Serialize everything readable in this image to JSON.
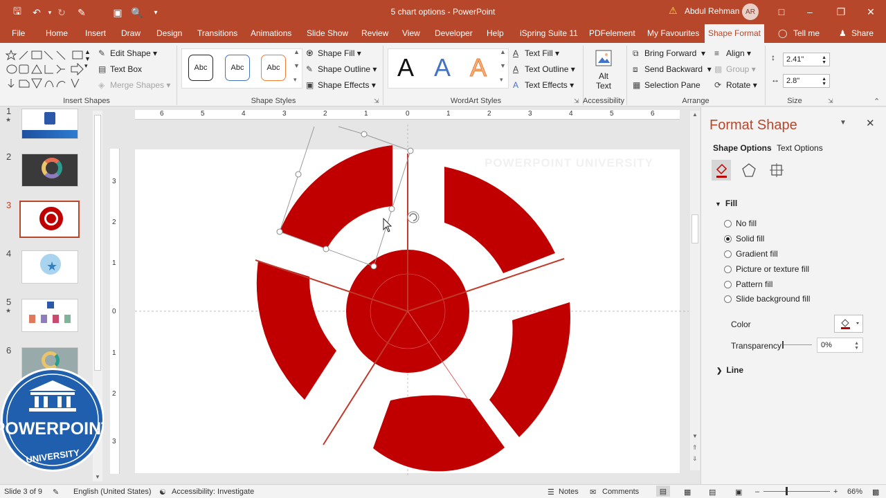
{
  "title_bar": {
    "document_title": "5 chart options - PowerPoint",
    "user_name": "Abdul Rehman",
    "avatar_initials": "AR",
    "quick_access": [
      "save-icon",
      "undo-icon",
      "redo-icon",
      "format-painter-icon",
      "from-beginning-icon",
      "print-preview-icon",
      "customize-icon"
    ]
  },
  "menu_tabs": [
    "File",
    "Home",
    "Insert",
    "Draw",
    "Design",
    "Transitions",
    "Animations",
    "Slide Show",
    "Review",
    "View",
    "Developer",
    "Help",
    "iSpring Suite 11",
    "PDFelement",
    "My Favourites",
    "Shape Format",
    "Tell me",
    "Share"
  ],
  "active_tab": "Shape Format",
  "ribbon": {
    "insert_shapes": {
      "label": "Insert Shapes",
      "edit_shape": "Edit Shape",
      "text_box": "Text Box",
      "merge_shapes": "Merge Shapes"
    },
    "shape_styles": {
      "label": "Shape Styles",
      "samples": [
        "Abc",
        "Abc",
        "Abc"
      ],
      "shape_fill": "Shape Fill",
      "shape_outline": "Shape Outline",
      "shape_effects": "Shape Effects"
    },
    "wordart_styles": {
      "label": "WordArt Styles",
      "samples": [
        "A",
        "A",
        "A"
      ],
      "text_fill": "Text Fill",
      "text_outline": "Text Outline",
      "text_effects": "Text Effects"
    },
    "accessibility": {
      "label": "Accessibility",
      "alt_text_line1": "Alt",
      "alt_text_line2": "Text"
    },
    "arrange": {
      "label": "Arrange",
      "bring_forward": "Bring Forward",
      "send_backward": "Send Backward",
      "selection_pane": "Selection Pane",
      "align": "Align",
      "group": "Group",
      "rotate": "Rotate"
    },
    "size": {
      "label": "Size",
      "height": "2.41\"",
      "width": "2.8\""
    }
  },
  "slides": [
    {
      "number": "1",
      "starred": true
    },
    {
      "number": "2",
      "starred": false
    },
    {
      "number": "3",
      "starred": false,
      "active": true
    },
    {
      "number": "4",
      "starred": false
    },
    {
      "number": "5",
      "starred": true
    },
    {
      "number": "6",
      "starred": false
    }
  ],
  "ruler": {
    "horizontal": [
      "6",
      "5",
      "4",
      "3",
      "2",
      "1",
      "0",
      "1",
      "2",
      "3",
      "4",
      "5",
      "6"
    ],
    "vertical": [
      "3",
      "2",
      "1",
      "0",
      "1",
      "2",
      "3"
    ]
  },
  "slide": {
    "watermark": "POWERPOINT UNIVERSITY",
    "colors": {
      "shape": "#c00000",
      "line": "#c0392b"
    }
  },
  "logo": {
    "line1": "POWERPOINT",
    "line2": "UNIVERSITY"
  },
  "format_pane": {
    "title": "Format Shape",
    "tabs": [
      "Shape Options",
      "Text Options"
    ],
    "section_fill": "Fill",
    "fill_options": [
      "No fill",
      "Solid fill",
      "Gradient fill",
      "Picture or texture fill",
      "Pattern fill",
      "Slide background fill"
    ],
    "selected_fill": "Solid fill",
    "color_label": "Color",
    "transparency_label": "Transparency",
    "transparency_value": "0%",
    "transparency_level": 0,
    "section_line": "Line"
  },
  "status_bar": {
    "slide_info": "Slide 3 of 9",
    "language": "English (United States)",
    "accessibility": "Accessibility: Investigate",
    "notes": "Notes",
    "comments": "Comments",
    "zoom": "66%"
  },
  "accent_color": "#b7472a"
}
